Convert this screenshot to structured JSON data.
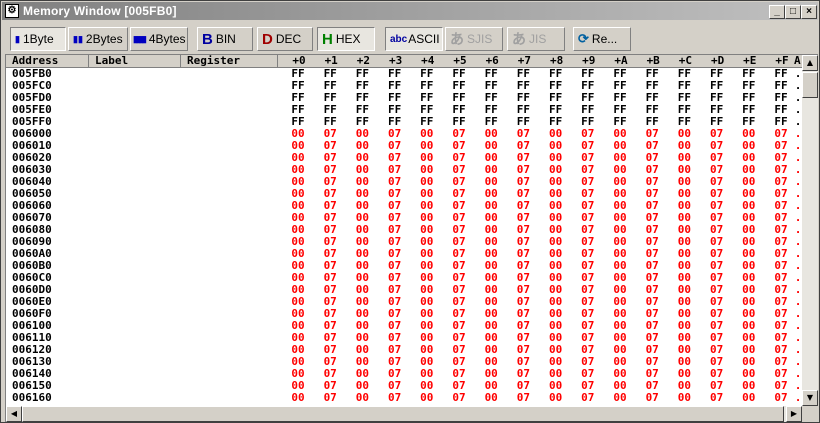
{
  "window": {
    "title": "Memory Window [005FB0]"
  },
  "titlebar_buttons": {
    "minimize": "_",
    "maximize": "□",
    "close": "×"
  },
  "toolbar": {
    "buttons": [
      {
        "icon": "▮",
        "label": "1Byte"
      },
      {
        "icon": "▮▮",
        "label": "2Bytes"
      },
      {
        "icon": "▮▮▮▮",
        "label": "4Bytes"
      },
      {
        "icon": "B",
        "label": "BIN"
      },
      {
        "icon": "D",
        "label": "DEC"
      },
      {
        "icon": "H",
        "label": "HEX"
      },
      {
        "icon": "abc",
        "label": "ASCII"
      },
      {
        "icon": "あ",
        "label": "SJIS"
      },
      {
        "icon": "あ",
        "label": "JIS"
      },
      {
        "icon": "⟳",
        "label": "Re..."
      }
    ]
  },
  "columns": {
    "address": "Address",
    "label": "Label",
    "register": "Register",
    "offsets": [
      "+0",
      "+1",
      "+2",
      "+3",
      "+4",
      "+5",
      "+6",
      "+7",
      "+8",
      "+9",
      "+A",
      "+B",
      "+C",
      "+D",
      "+E",
      "+F"
    ],
    "ascii": "A"
  },
  "rows": [
    {
      "addr": "005FB0",
      "bytes": [
        "FF",
        "FF",
        "FF",
        "FF",
        "FF",
        "FF",
        "FF",
        "FF",
        "FF",
        "FF",
        "FF",
        "FF",
        "FF",
        "FF",
        "FF",
        "FF"
      ],
      "ascii": "."
    },
    {
      "addr": "005FC0",
      "bytes": [
        "FF",
        "FF",
        "FF",
        "FF",
        "FF",
        "FF",
        "FF",
        "FF",
        "FF",
        "FF",
        "FF",
        "FF",
        "FF",
        "FF",
        "FF",
        "FF"
      ],
      "ascii": "."
    },
    {
      "addr": "005FD0",
      "bytes": [
        "FF",
        "FF",
        "FF",
        "FF",
        "FF",
        "FF",
        "FF",
        "FF",
        "FF",
        "FF",
        "FF",
        "FF",
        "FF",
        "FF",
        "FF",
        "FF"
      ],
      "ascii": "."
    },
    {
      "addr": "005FE0",
      "bytes": [
        "FF",
        "FF",
        "FF",
        "FF",
        "FF",
        "FF",
        "FF",
        "FF",
        "FF",
        "FF",
        "FF",
        "FF",
        "FF",
        "FF",
        "FF",
        "FF"
      ],
      "ascii": "."
    },
    {
      "addr": "005FF0",
      "bytes": [
        "FF",
        "FF",
        "FF",
        "FF",
        "FF",
        "FF",
        "FF",
        "FF",
        "FF",
        "FF",
        "FF",
        "FF",
        "FF",
        "FF",
        "FF",
        "FF"
      ],
      "ascii": "."
    },
    {
      "addr": "006000",
      "bytes": [
        "00",
        "07",
        "00",
        "07",
        "00",
        "07",
        "00",
        "07",
        "00",
        "07",
        "00",
        "07",
        "00",
        "07",
        "00",
        "07"
      ],
      "ascii": "."
    },
    {
      "addr": "006010",
      "bytes": [
        "00",
        "07",
        "00",
        "07",
        "00",
        "07",
        "00",
        "07",
        "00",
        "07",
        "00",
        "07",
        "00",
        "07",
        "00",
        "07"
      ],
      "ascii": "."
    },
    {
      "addr": "006020",
      "bytes": [
        "00",
        "07",
        "00",
        "07",
        "00",
        "07",
        "00",
        "07",
        "00",
        "07",
        "00",
        "07",
        "00",
        "07",
        "00",
        "07"
      ],
      "ascii": "."
    },
    {
      "addr": "006030",
      "bytes": [
        "00",
        "07",
        "00",
        "07",
        "00",
        "07",
        "00",
        "07",
        "00",
        "07",
        "00",
        "07",
        "00",
        "07",
        "00",
        "07"
      ],
      "ascii": "."
    },
    {
      "addr": "006040",
      "bytes": [
        "00",
        "07",
        "00",
        "07",
        "00",
        "07",
        "00",
        "07",
        "00",
        "07",
        "00",
        "07",
        "00",
        "07",
        "00",
        "07"
      ],
      "ascii": "."
    },
    {
      "addr": "006050",
      "bytes": [
        "00",
        "07",
        "00",
        "07",
        "00",
        "07",
        "00",
        "07",
        "00",
        "07",
        "00",
        "07",
        "00",
        "07",
        "00",
        "07"
      ],
      "ascii": "."
    },
    {
      "addr": "006060",
      "bytes": [
        "00",
        "07",
        "00",
        "07",
        "00",
        "07",
        "00",
        "07",
        "00",
        "07",
        "00",
        "07",
        "00",
        "07",
        "00",
        "07"
      ],
      "ascii": "."
    },
    {
      "addr": "006070",
      "bytes": [
        "00",
        "07",
        "00",
        "07",
        "00",
        "07",
        "00",
        "07",
        "00",
        "07",
        "00",
        "07",
        "00",
        "07",
        "00",
        "07"
      ],
      "ascii": "."
    },
    {
      "addr": "006080",
      "bytes": [
        "00",
        "07",
        "00",
        "07",
        "00",
        "07",
        "00",
        "07",
        "00",
        "07",
        "00",
        "07",
        "00",
        "07",
        "00",
        "07"
      ],
      "ascii": "."
    },
    {
      "addr": "006090",
      "bytes": [
        "00",
        "07",
        "00",
        "07",
        "00",
        "07",
        "00",
        "07",
        "00",
        "07",
        "00",
        "07",
        "00",
        "07",
        "00",
        "07"
      ],
      "ascii": "."
    },
    {
      "addr": "0060A0",
      "bytes": [
        "00",
        "07",
        "00",
        "07",
        "00",
        "07",
        "00",
        "07",
        "00",
        "07",
        "00",
        "07",
        "00",
        "07",
        "00",
        "07"
      ],
      "ascii": "."
    },
    {
      "addr": "0060B0",
      "bytes": [
        "00",
        "07",
        "00",
        "07",
        "00",
        "07",
        "00",
        "07",
        "00",
        "07",
        "00",
        "07",
        "00",
        "07",
        "00",
        "07"
      ],
      "ascii": "."
    },
    {
      "addr": "0060C0",
      "bytes": [
        "00",
        "07",
        "00",
        "07",
        "00",
        "07",
        "00",
        "07",
        "00",
        "07",
        "00",
        "07",
        "00",
        "07",
        "00",
        "07"
      ],
      "ascii": "."
    },
    {
      "addr": "0060D0",
      "bytes": [
        "00",
        "07",
        "00",
        "07",
        "00",
        "07",
        "00",
        "07",
        "00",
        "07",
        "00",
        "07",
        "00",
        "07",
        "00",
        "07"
      ],
      "ascii": "."
    },
    {
      "addr": "0060E0",
      "bytes": [
        "00",
        "07",
        "00",
        "07",
        "00",
        "07",
        "00",
        "07",
        "00",
        "07",
        "00",
        "07",
        "00",
        "07",
        "00",
        "07"
      ],
      "ascii": "."
    },
    {
      "addr": "0060F0",
      "bytes": [
        "00",
        "07",
        "00",
        "07",
        "00",
        "07",
        "00",
        "07",
        "00",
        "07",
        "00",
        "07",
        "00",
        "07",
        "00",
        "07"
      ],
      "ascii": "."
    },
    {
      "addr": "006100",
      "bytes": [
        "00",
        "07",
        "00",
        "07",
        "00",
        "07",
        "00",
        "07",
        "00",
        "07",
        "00",
        "07",
        "00",
        "07",
        "00",
        "07"
      ],
      "ascii": "."
    },
    {
      "addr": "006110",
      "bytes": [
        "00",
        "07",
        "00",
        "07",
        "00",
        "07",
        "00",
        "07",
        "00",
        "07",
        "00",
        "07",
        "00",
        "07",
        "00",
        "07"
      ],
      "ascii": "."
    },
    {
      "addr": "006120",
      "bytes": [
        "00",
        "07",
        "00",
        "07",
        "00",
        "07",
        "00",
        "07",
        "00",
        "07",
        "00",
        "07",
        "00",
        "07",
        "00",
        "07"
      ],
      "ascii": "."
    },
    {
      "addr": "006130",
      "bytes": [
        "00",
        "07",
        "00",
        "07",
        "00",
        "07",
        "00",
        "07",
        "00",
        "07",
        "00",
        "07",
        "00",
        "07",
        "00",
        "07"
      ],
      "ascii": "."
    },
    {
      "addr": "006140",
      "bytes": [
        "00",
        "07",
        "00",
        "07",
        "00",
        "07",
        "00",
        "07",
        "00",
        "07",
        "00",
        "07",
        "00",
        "07",
        "00",
        "07"
      ],
      "ascii": "."
    },
    {
      "addr": "006150",
      "bytes": [
        "00",
        "07",
        "00",
        "07",
        "00",
        "07",
        "00",
        "07",
        "00",
        "07",
        "00",
        "07",
        "00",
        "07",
        "00",
        "07"
      ],
      "ascii": "."
    },
    {
      "addr": "006160",
      "bytes": [
        "00",
        "07",
        "00",
        "07",
        "00",
        "07",
        "00",
        "07",
        "00",
        "07",
        "00",
        "07",
        "00",
        "07",
        "00",
        "07"
      ],
      "ascii": "."
    }
  ],
  "scrollbars": {
    "up": "▲",
    "down": "▼",
    "left": "◀",
    "right": "▶"
  },
  "colors": {
    "unchanged": "#000000",
    "changed": "#ff0000",
    "titlebar": "#808080",
    "face": "#d4d0c8"
  }
}
